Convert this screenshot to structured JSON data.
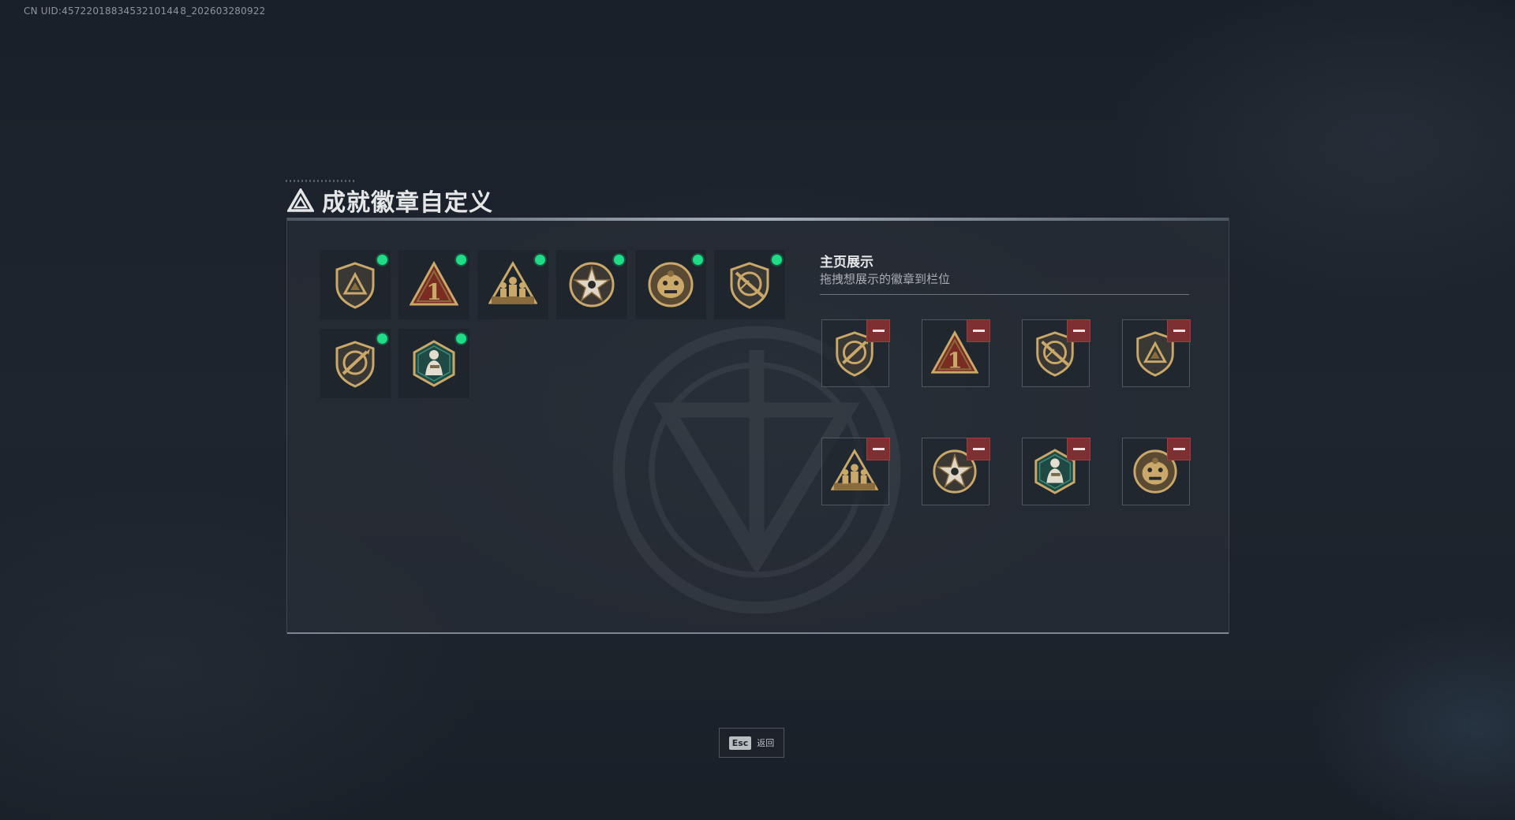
{
  "uid_text": "CN UID:4572201883453210144 8_202603280922",
  "title": "成就徽章自定义",
  "showcase": {
    "title": "主页展示",
    "subtitle": "拖拽想展示的徽章到栏位"
  },
  "inventory_badges": [
    {
      "icon": "shield-triangle-badge-icon",
      "equipped": true
    },
    {
      "icon": "triangle-number-one-badge-icon",
      "equipped": true
    },
    {
      "icon": "squad-triangle-badge-icon",
      "equipped": true
    },
    {
      "icon": "star-medal-badge-icon",
      "equipped": true
    },
    {
      "icon": "brute-face-badge-icon",
      "equipped": true
    },
    {
      "icon": "shield-crossed-rifle-badge-icon",
      "equipped": true
    },
    {
      "icon": "shield-crossed-knife-badge-icon",
      "equipped": true
    },
    {
      "icon": "hexagon-soldier-badge-icon",
      "equipped": true
    }
  ],
  "showcase_slots": [
    {
      "icon": "shield-crossed-knife-badge-icon"
    },
    {
      "icon": "triangle-number-one-badge-icon"
    },
    {
      "icon": "shield-crossed-rifle-badge-icon"
    },
    {
      "icon": "shield-triangle-badge-icon"
    },
    {
      "icon": "squad-triangle-badge-icon"
    },
    {
      "icon": "star-medal-badge-icon"
    },
    {
      "icon": "hexagon-soldier-badge-icon"
    },
    {
      "icon": "brute-face-badge-icon"
    }
  ],
  "footer": {
    "esc_key": "Esc",
    "esc_label": "返回"
  },
  "colors": {
    "equipped_dot": "#1fdc86",
    "remove_button": "#7e2f31",
    "badge_gold": "#c9a86a"
  }
}
